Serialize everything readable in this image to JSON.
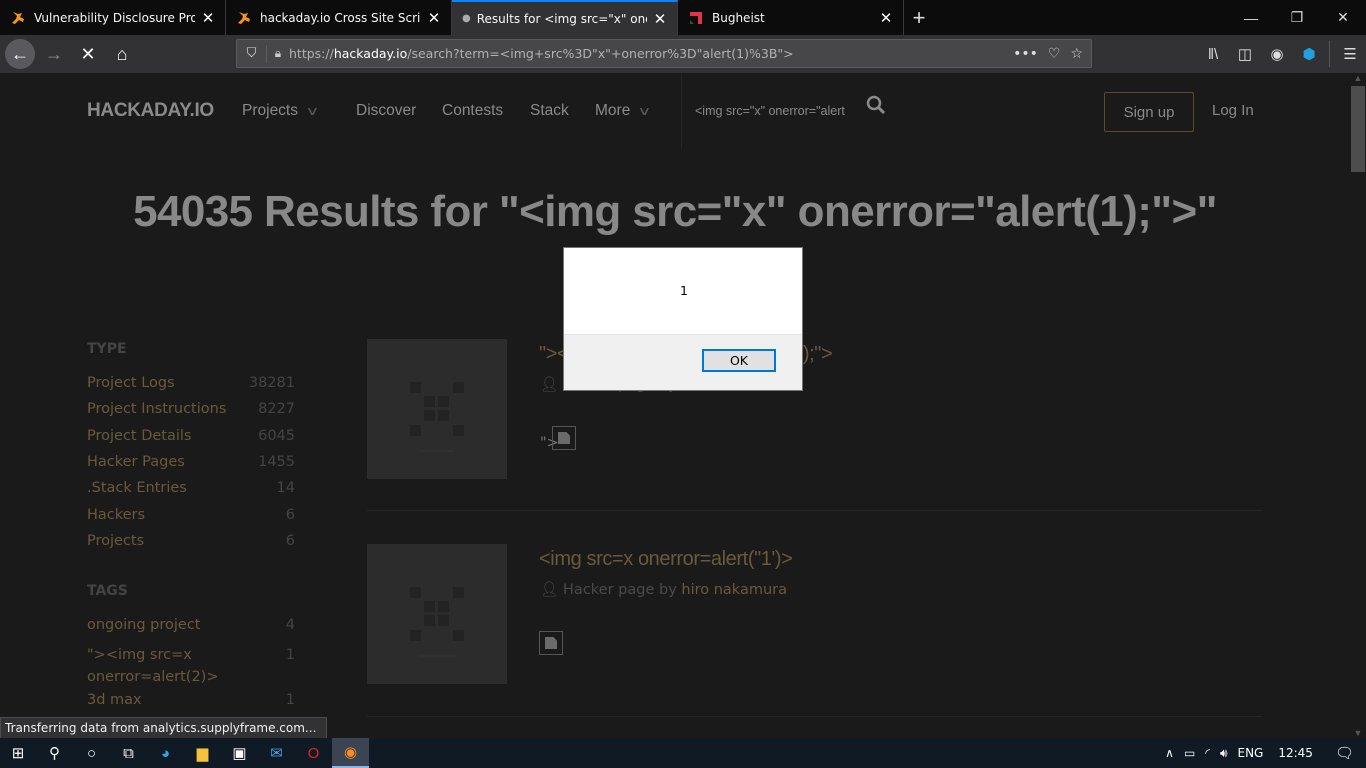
{
  "browser": {
    "tabs": [
      {
        "title": "Vulnerability Disclosure Program",
        "favicon": "hackerone-icon",
        "active": false
      },
      {
        "title": "hackaday.io Cross Site Scripting",
        "favicon": "hackerone-icon",
        "active": false
      },
      {
        "title": "Results for <img src=\"x\" onerror",
        "favicon": "loading-dot",
        "active": true
      },
      {
        "title": "Bugheist",
        "favicon": "bugheist-icon",
        "active": false
      }
    ],
    "new_tab_label": "+",
    "url_prefix": "https://",
    "url_host": "hackaday.io",
    "url_path": "/search?term=<img+src%3D\"x\"+onerror%3D\"alert(1)%3B\">",
    "status_text": "Transferring data from analytics.supplyframe.com..."
  },
  "site": {
    "logo": "HACKADAY.IO",
    "nav": [
      {
        "label": "Projects",
        "has_dropdown": true
      },
      {
        "label": "Discover",
        "has_dropdown": false
      },
      {
        "label": "Contests",
        "has_dropdown": false
      },
      {
        "label": "Stack",
        "has_dropdown": false
      },
      {
        "label": "More",
        "has_dropdown": true
      }
    ],
    "search_value": "<img src=\"x\" onerror=\"alert",
    "signup_label": "Sign up",
    "login_label": "Log In"
  },
  "results": {
    "heading": "54035 Results for \"<img src=\"x\" onerror=\"alert(1);\">\"",
    "items": [
      {
        "title": "\"><img src=\"x\" onerror=\"alert(1);\">",
        "title_prefix_visible": "\">",
        "title_suffix_visible": ">",
        "byline_type": "Hacker page by",
        "author": "",
        "body_prefix": "\">",
        "thumb_caption": "PHOTO COMING SOON"
      },
      {
        "title": "<img src=x onerror=alert(\"1')>",
        "byline_type": "Hacker page by",
        "author": "hiro nakamura",
        "body_prefix": "",
        "thumb_caption": "PHOTO COMING SOON"
      }
    ]
  },
  "sidebar": {
    "type_heading": "TYPE",
    "types": [
      {
        "label": "Project Logs",
        "count": "38281"
      },
      {
        "label": "Project Instructions",
        "count": "8227"
      },
      {
        "label": "Project Details",
        "count": "6045"
      },
      {
        "label": "Hacker Pages",
        "count": "1455"
      },
      {
        "label": ".Stack Entries",
        "count": "14"
      },
      {
        "label": "Hackers",
        "count": "6"
      },
      {
        "label": "Projects",
        "count": "6"
      }
    ],
    "tags_heading": "TAGS",
    "tags": [
      {
        "label": "ongoing project",
        "count": "4"
      },
      {
        "label": "\"><img src=x onerror=alert(2)>",
        "label_line1": "\"><img src=x",
        "label_line2": "onerror=alert(2)>",
        "count": "1"
      },
      {
        "label": "3d max",
        "count": "1"
      }
    ]
  },
  "alert": {
    "message": "1",
    "ok_label": "OK"
  },
  "taskbar": {
    "apps": [
      "start",
      "search",
      "cortana",
      "task-view",
      "edge",
      "file-explorer",
      "store",
      "mail",
      "opera",
      "firefox"
    ],
    "language": "ENG",
    "time": "12:45"
  },
  "colors": {
    "accent_link": "#6b5a3a",
    "tab_active_indicator": "#0a84ff",
    "dialog_button_focus": "#0078d7"
  }
}
